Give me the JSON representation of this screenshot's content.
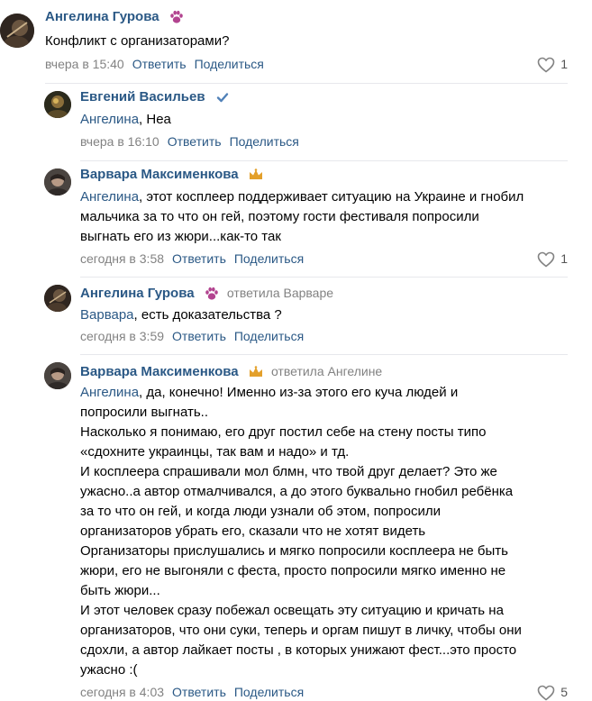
{
  "actions": {
    "reply": "Ответить",
    "share": "Поделиться"
  },
  "comments": [
    {
      "author": "Ангелина Гурова",
      "lines": [
        "Конфликт с организаторами?"
      ],
      "time": "вчера в 15:40",
      "likes": "1"
    },
    {
      "author": "Евгений Васильев",
      "mention": "Ангелина",
      "lines": [
        ", Неа"
      ],
      "time": "вчера в 16:10"
    },
    {
      "author": "Варвара Максименкова",
      "mention": "Ангелина",
      "lines": [
        ", этот косплеер поддерживает ситуацию на Украине и гнобил",
        "мальчика за то что он гей, поэтому гости фестиваля попросили",
        "выгнать его из жюри...как-то так"
      ],
      "time": "сегодня в 3:58",
      "likes": "1"
    },
    {
      "author": "Ангелина Гурова",
      "replied": "ответила Варваре",
      "mention": "Варвара",
      "lines": [
        ", есть доказательства ?"
      ],
      "time": "сегодня в 3:59"
    },
    {
      "author": "Варвара Максименкова",
      "replied": "ответила Ангелине",
      "mention": "Ангелина",
      "lines": [
        ", да, конечно! Именно из-за этого его куча людей и",
        "попросили выгнать..",
        "Насколько я понимаю, его друг постил себе на стену посты типо",
        "«сдохните украинцы, так вам и надо» и тд.",
        "И косплеера спрашивали мол блмн, что твой друг делает? Это же",
        "ужасно..а автор отмалчивался, а до этого буквально гнобил ребёнка",
        "за то что он гей, и когда люди узнали об этом, попросили",
        "организаторов убрать его, сказали что не хотят видеть",
        "Организаторы прислушались и мягко попросили косплеера не быть",
        "жюри, его не выгоняли с феста, просто попросили мягко именно не",
        "быть жюри...",
        "И этот человек сразу побежал освещать эту ситуацию и кричать на",
        "организаторов, что они суки, теперь и оргам пишут в личку, чтобы они",
        "сдохли, а автор лайкает посты , в которых унижают фест...это просто",
        "ужасно :("
      ],
      "time": "сегодня в 4:03",
      "likes": "5"
    }
  ],
  "colors": {
    "link": "#2a5885",
    "meta": "#828282",
    "badge_paw": "#b2438f",
    "badge_crown": "#e3a02b",
    "verified": "#5181b8"
  }
}
